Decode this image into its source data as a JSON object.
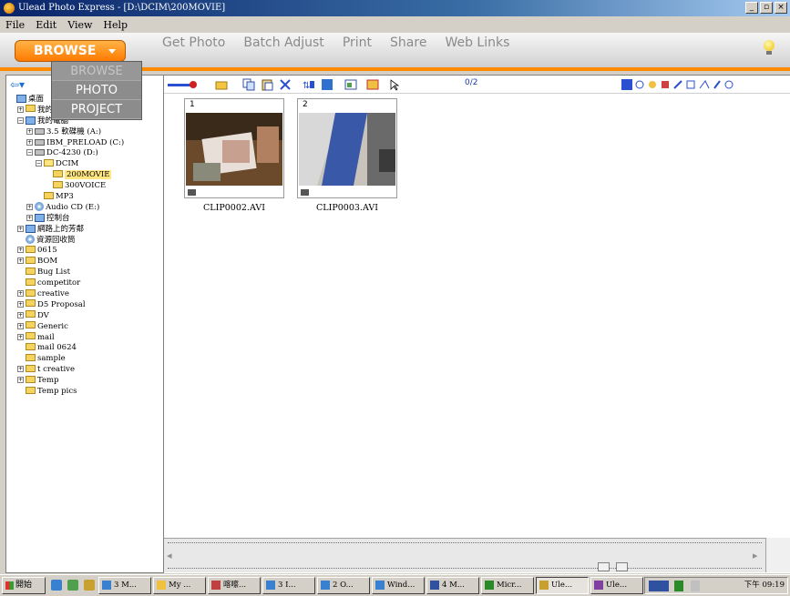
{
  "window": {
    "title": "Ulead Photo Express - [D:\\DCIM\\200MOVIE]",
    "controls": [
      "_",
      "▫",
      "×"
    ]
  },
  "menu": [
    "File",
    "Edit",
    "View",
    "Help"
  ],
  "modebar": {
    "current_mode": "BROWSE",
    "tabs": [
      "Get Photo",
      "Batch Adjust",
      "Print",
      "Share",
      "Web Links"
    ]
  },
  "mode_dropdown": [
    "BROWSE",
    "PHOTO",
    "PROJECT"
  ],
  "tree": [
    {
      "label": "桌面",
      "level": 0,
      "icon": "desktop-icon"
    },
    {
      "label": "我的",
      "level": 1,
      "icon": "documents-icon"
    },
    {
      "label": "我的電腦",
      "level": 1,
      "icon": "computer-icon"
    },
    {
      "label": "3.5 軟碟機 (A:)",
      "level": 2,
      "icon": "floppy-icon"
    },
    {
      "label": "IBM_PRELOAD (C:)",
      "level": 2,
      "icon": "drive-icon"
    },
    {
      "label": "DC-4230 (D:)",
      "level": 2,
      "icon": "drive-icon"
    },
    {
      "label": "DCIM",
      "level": 3,
      "icon": "folder-open-icon"
    },
    {
      "label": "200MOVIE",
      "level": 4,
      "icon": "folder-icon",
      "selected": true
    },
    {
      "label": "300VOICE",
      "level": 4,
      "icon": "folder-icon"
    },
    {
      "label": "MP3",
      "level": 3,
      "icon": "folder-icon"
    },
    {
      "label": "Audio CD (E:)",
      "level": 2,
      "icon": "cdrom-icon"
    },
    {
      "label": "控制台",
      "level": 2,
      "icon": "control-panel-icon"
    },
    {
      "label": "網路上的芳鄰",
      "level": 1,
      "icon": "network-icon"
    },
    {
      "label": "資源回收筒",
      "level": 1,
      "icon": "recycle-bin-icon"
    },
    {
      "label": "0615",
      "level": 1,
      "icon": "folder-icon"
    },
    {
      "label": "BOM",
      "level": 1,
      "icon": "folder-icon"
    },
    {
      "label": "Bug List",
      "level": 1,
      "icon": "folder-icon"
    },
    {
      "label": "competitor",
      "level": 1,
      "icon": "folder-icon"
    },
    {
      "label": "creative",
      "level": 1,
      "icon": "folder-icon"
    },
    {
      "label": "D5 Proposal",
      "level": 1,
      "icon": "folder-icon"
    },
    {
      "label": "DV",
      "level": 1,
      "icon": "folder-icon"
    },
    {
      "label": "Generic",
      "level": 1,
      "icon": "folder-icon"
    },
    {
      "label": "mail",
      "level": 1,
      "icon": "folder-icon"
    },
    {
      "label": "mail 0624",
      "level": 1,
      "icon": "folder-icon"
    },
    {
      "label": "sample",
      "level": 1,
      "icon": "folder-icon"
    },
    {
      "label": "t creative",
      "level": 1,
      "icon": "folder-icon"
    },
    {
      "label": "Temp",
      "level": 1,
      "icon": "folder-icon"
    },
    {
      "label": "Temp pics",
      "level": 1,
      "icon": "folder-icon"
    }
  ],
  "thumbnails": {
    "counter": "0/2",
    "items": [
      {
        "index": "1",
        "filename": "CLIP0002.AVI"
      },
      {
        "index": "2",
        "filename": "CLIP0003.AVI"
      }
    ]
  },
  "taskbar": {
    "start_label": "開始",
    "tasks": [
      "3 M...",
      "My ...",
      "喀嚓...",
      "3 I...",
      "2 O...",
      "Wind...",
      "4 M...",
      "Micr...",
      "Ule...",
      "Ule..."
    ],
    "active_task": 8,
    "clock": "下午 09:19"
  },
  "colors": {
    "accent": "#ff8a00",
    "titlebar": "#0a246a",
    "selected_folder": "#ffe680"
  }
}
